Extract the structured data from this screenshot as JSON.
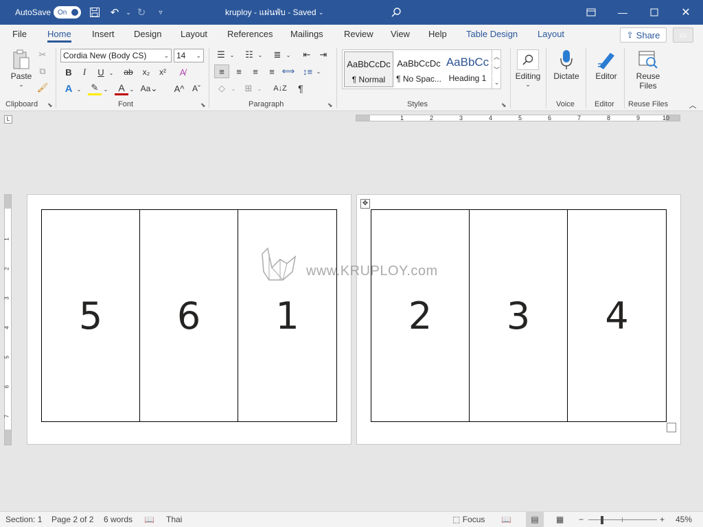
{
  "titlebar": {
    "autosave_label": "AutoSave",
    "autosave_state": "On",
    "doc_title": "kruploy - แผ่นพับ - Saved",
    "title_dropdown": "⌄"
  },
  "tabs": [
    {
      "label": "File"
    },
    {
      "label": "Home"
    },
    {
      "label": "Insert"
    },
    {
      "label": "Design"
    },
    {
      "label": "Layout"
    },
    {
      "label": "References"
    },
    {
      "label": "Mailings"
    },
    {
      "label": "Review"
    },
    {
      "label": "View"
    },
    {
      "label": "Help"
    },
    {
      "label": "Table Design"
    },
    {
      "label": "Layout"
    }
  ],
  "share_label": "Share",
  "ribbon": {
    "clipboard": {
      "paste_label": "Paste",
      "group_label": "Clipboard"
    },
    "font": {
      "font_name": "Cordia New (Body CS)",
      "font_size": "14",
      "group_label": "Font"
    },
    "paragraph": {
      "group_label": "Paragraph"
    },
    "styles": {
      "group_label": "Styles",
      "items": [
        {
          "preview": "AaBbCcDc",
          "name": "¶ Normal"
        },
        {
          "preview": "AaBbCcDc",
          "name": "¶ No Spac..."
        },
        {
          "preview": "AaBbCc",
          "name": "Heading 1"
        }
      ]
    },
    "editing": {
      "label": "Editing"
    },
    "voice": {
      "label": "Dictate",
      "group_label": "Voice"
    },
    "editor": {
      "label": "Editor",
      "group_label": "Editor"
    },
    "reuse": {
      "label_line1": "Reuse",
      "label_line2": "Files",
      "group_label": "Reuse Files"
    }
  },
  "hruler_numbers": [
    "1",
    "2",
    "3",
    "4",
    "5",
    "6",
    "7",
    "8",
    "9",
    "10"
  ],
  "vruler_numbers": [
    "1",
    "2",
    "3",
    "4",
    "5",
    "6",
    "7"
  ],
  "pages": [
    {
      "cells": [
        "5",
        "6",
        "1"
      ]
    },
    {
      "cells": [
        "2",
        "3",
        "4"
      ]
    }
  ],
  "watermark": "www.KRUPLOY.com",
  "status": {
    "section": "Section: 1",
    "page": "Page 2 of 2",
    "words": "6 words",
    "language": "Thai",
    "focus": "Focus",
    "zoom": "45%"
  },
  "colors": {
    "brand": "#2b579a"
  }
}
